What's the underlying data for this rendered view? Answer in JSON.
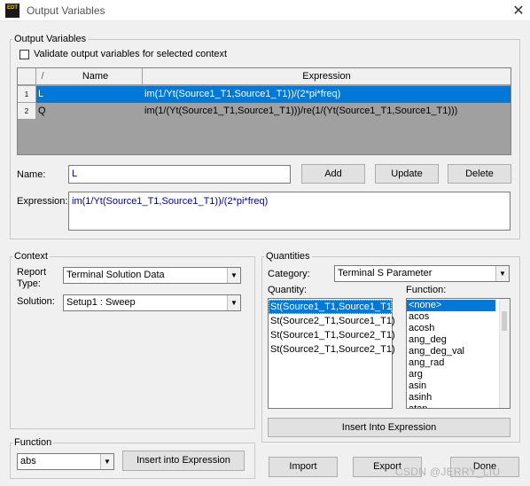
{
  "window": {
    "title": "Output Variables",
    "icon_text": "EDT",
    "close_glyph": "✕"
  },
  "output_variables": {
    "legend": "Output Variables",
    "validate_label": "Validate output variables for selected context",
    "validate_checked": false,
    "columns": [
      "/",
      "Name",
      "Expression"
    ],
    "rows": [
      {
        "num": "1",
        "name": "L",
        "expression": "im(1/Yt(Source1_T1,Source1_T1))/(2*pi*freq)",
        "selected": true
      },
      {
        "num": "2",
        "name": "Q",
        "expression": "im(1/(Yt(Source1_T1,Source1_T1)))/re(1/(Yt(Source1_T1,Source1_T1)))",
        "selected": false
      }
    ],
    "name_label": "Name:",
    "name_value": "L",
    "add_label": "Add",
    "update_label": "Update",
    "delete_label": "Delete",
    "expression_label": "Expression:",
    "expression_value": "im(1/Yt(Source1_T1,Source1_T1))/(2*pi*freq)"
  },
  "context": {
    "legend": "Context",
    "report_type_label_1": "Report",
    "report_type_label_2": "Type:",
    "report_type_value": "Terminal Solution Data",
    "solution_label": "Solution:",
    "solution_value": "Setup1 : Sweep"
  },
  "quantities": {
    "legend": "Quantities",
    "category_label": "Category:",
    "category_value": "Terminal S Parameter",
    "quantity_label": "Quantity:",
    "quantity_items": [
      "St(Source1_T1,Source1_T1)",
      "St(Source2_T1,Source1_T1)",
      "St(Source1_T1,Source2_T1)",
      "St(Source2_T1,Source2_T1)"
    ],
    "function_label": "Function:",
    "function_items": [
      "<none>",
      "acos",
      "acosh",
      "ang_deg",
      "ang_deg_val",
      "ang_rad",
      "arg",
      "asin",
      "asinh",
      "atan"
    ],
    "insert_label": "Insert Into Expression"
  },
  "function": {
    "legend": "Function",
    "value": "abs",
    "insert_label": "Insert into Expression"
  },
  "buttons": {
    "import_label": "Import",
    "export_label": "Export",
    "done_label": "Done"
  },
  "watermark": "CSDN @JERRY_LIU",
  "colors": {
    "selection": "#0078d7",
    "expression_text": "#0000a0"
  }
}
